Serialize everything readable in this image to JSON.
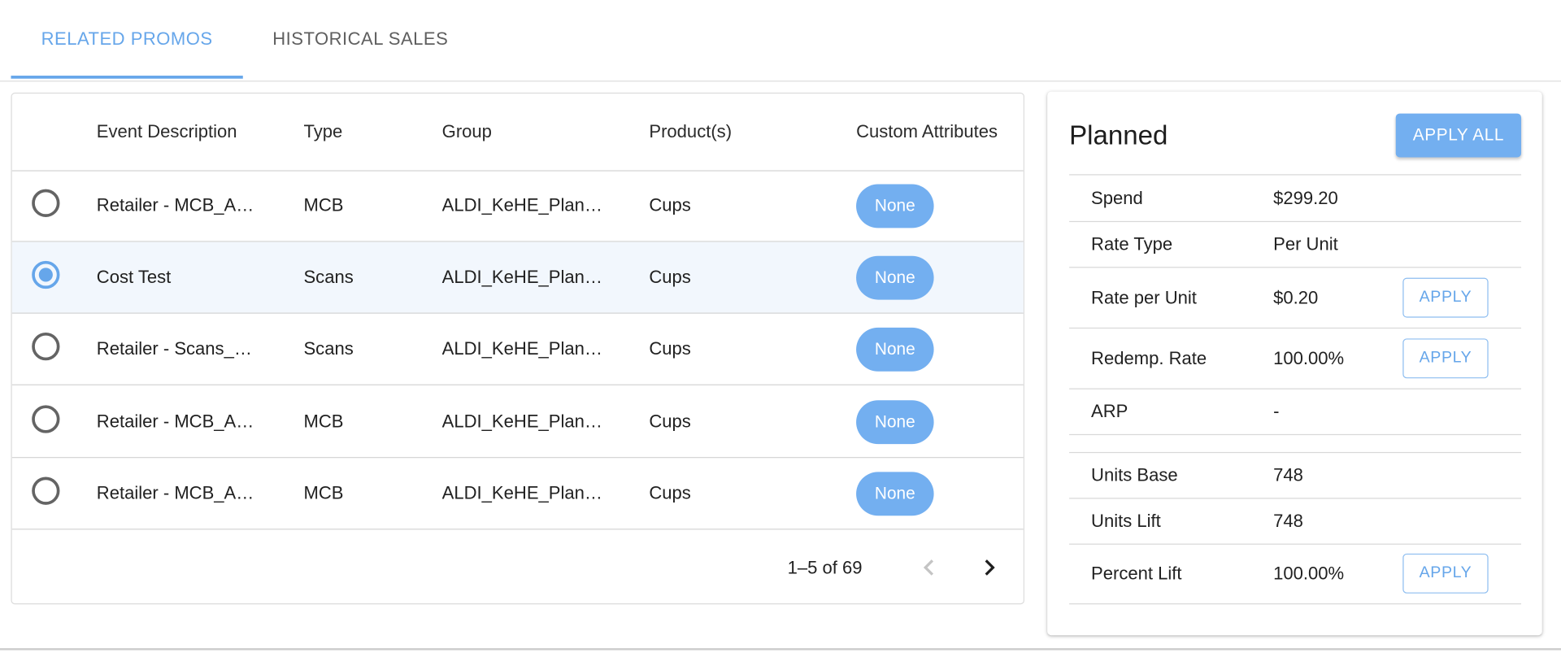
{
  "tabs": [
    {
      "label": "RELATED PROMOS",
      "active": true
    },
    {
      "label": "HISTORICAL SALES",
      "active": false
    }
  ],
  "table": {
    "columns": [
      "Event Description",
      "Type",
      "Group",
      "Product(s)",
      "Custom Attributes"
    ],
    "rows": [
      {
        "selected": false,
        "description": "Retailer - MCB_A…",
        "type": "MCB",
        "group": "ALDI_KeHE_Plan…",
        "products": "Cups",
        "custom_attributes": "None"
      },
      {
        "selected": true,
        "description": "Cost Test",
        "type": "Scans",
        "group": "ALDI_KeHE_Plan…",
        "products": "Cups",
        "custom_attributes": "None"
      },
      {
        "selected": false,
        "description": "Retailer - Scans_…",
        "type": "Scans",
        "group": "ALDI_KeHE_Plan…",
        "products": "Cups",
        "custom_attributes": "None"
      },
      {
        "selected": false,
        "description": "Retailer - MCB_A…",
        "type": "MCB",
        "group": "ALDI_KeHE_Plan…",
        "products": "Cups",
        "custom_attributes": "None"
      },
      {
        "selected": false,
        "description": "Retailer - MCB_A…",
        "type": "MCB",
        "group": "ALDI_KeHE_Plan…",
        "products": "Cups",
        "custom_attributes": "None"
      }
    ],
    "pagination": {
      "range_text": "1–5 of 69",
      "prev_icon": "chevron-left-icon",
      "next_icon": "chevron-right-icon"
    }
  },
  "planned": {
    "title": "Planned",
    "apply_all_label": "APPLY ALL",
    "apply_label": "APPLY",
    "rows": [
      {
        "label": "Spend",
        "value": "$299.20",
        "has_apply": false
      },
      {
        "label": "Rate Type",
        "value": "Per Unit",
        "has_apply": false
      },
      {
        "label": "Rate per Unit",
        "value": "$0.20",
        "has_apply": true
      },
      {
        "label": "Redemp. Rate",
        "value": "100.00%",
        "has_apply": true
      },
      {
        "label": "ARP",
        "value": "-",
        "has_apply": false
      },
      {
        "label": "",
        "value": "",
        "has_apply": false
      },
      {
        "label": "Units Base",
        "value": "748",
        "has_apply": false
      },
      {
        "label": "Units Lift",
        "value": "748",
        "has_apply": false
      },
      {
        "label": "Percent Lift",
        "value": "100.00%",
        "has_apply": true
      }
    ]
  },
  "colors": {
    "accent": "#66a6ea",
    "chip": "#73aff0",
    "selected_row": "#f2f7fd"
  }
}
